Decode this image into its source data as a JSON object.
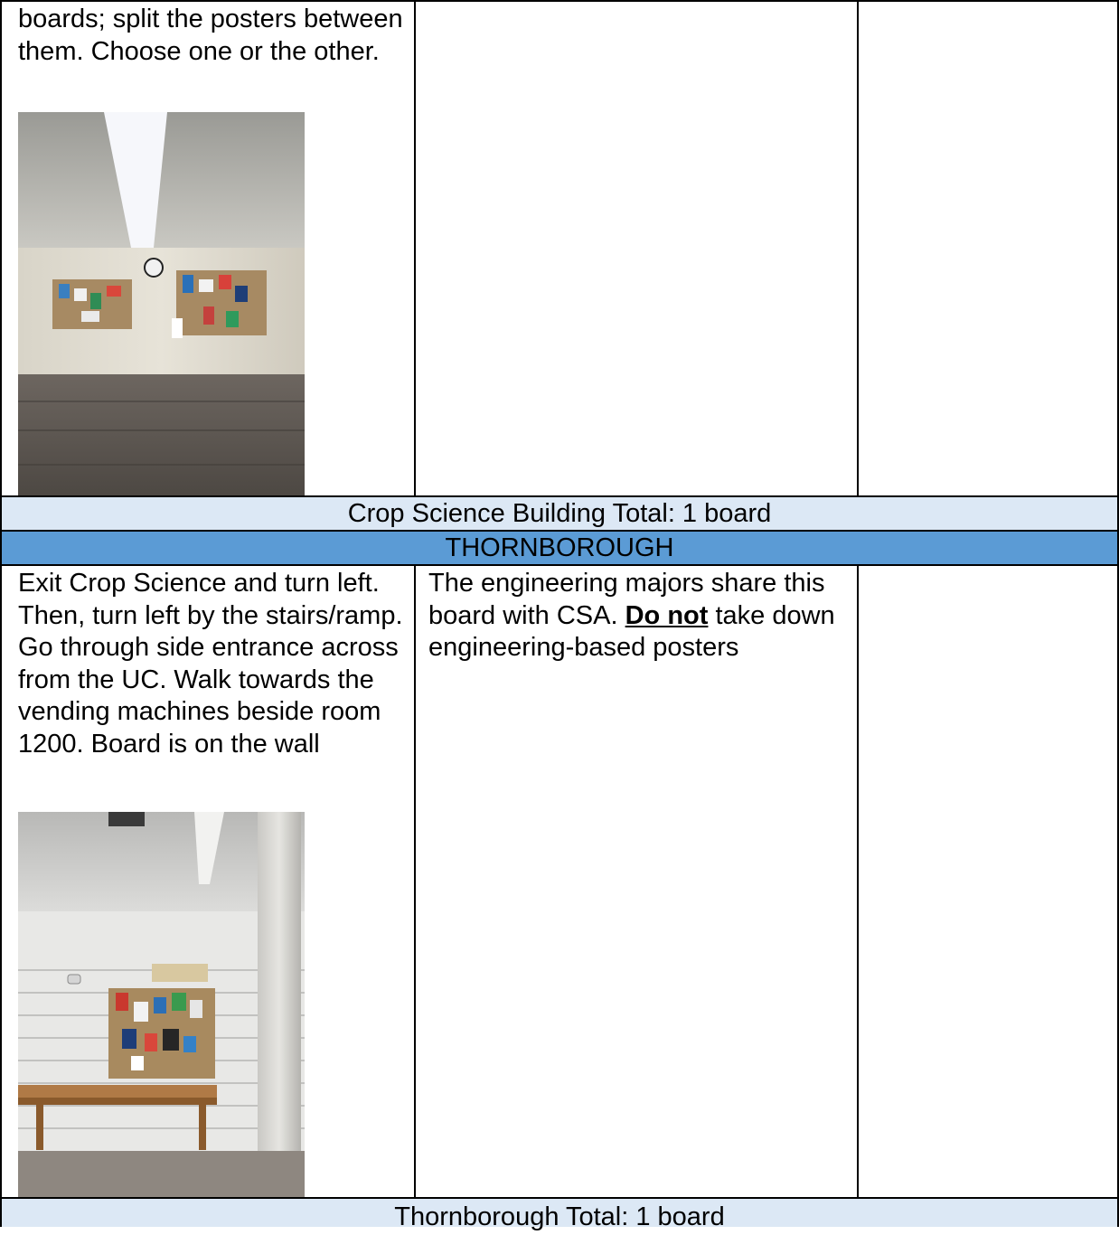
{
  "rows": [
    {
      "directions": "boards; split the posters between them. Choose one or the other.",
      "photo": "hallway-bulletin-boards-photo"
    },
    {
      "directions": "Exit Crop Science and turn left. Then, turn left by the stairs/ramp. Go through side entrance across from the UC. Walk towards the vending machines beside room 1200. Board is on the wall",
      "notes_before": "The engineering majors share this board with CSA. ",
      "notes_emphasis": "Do not",
      "notes_after": " take down engineering-based posters",
      "photo": "thornborough-bulletin-board-photo"
    }
  ],
  "crop_total": "Crop Science Building Total: 1 board",
  "section_header": "THORNBOROUGH",
  "thorn_total": "Thornborough Total: 1 board",
  "colors": {
    "total_bg": "#dce8f5",
    "header_bg": "#5b9bd5"
  }
}
